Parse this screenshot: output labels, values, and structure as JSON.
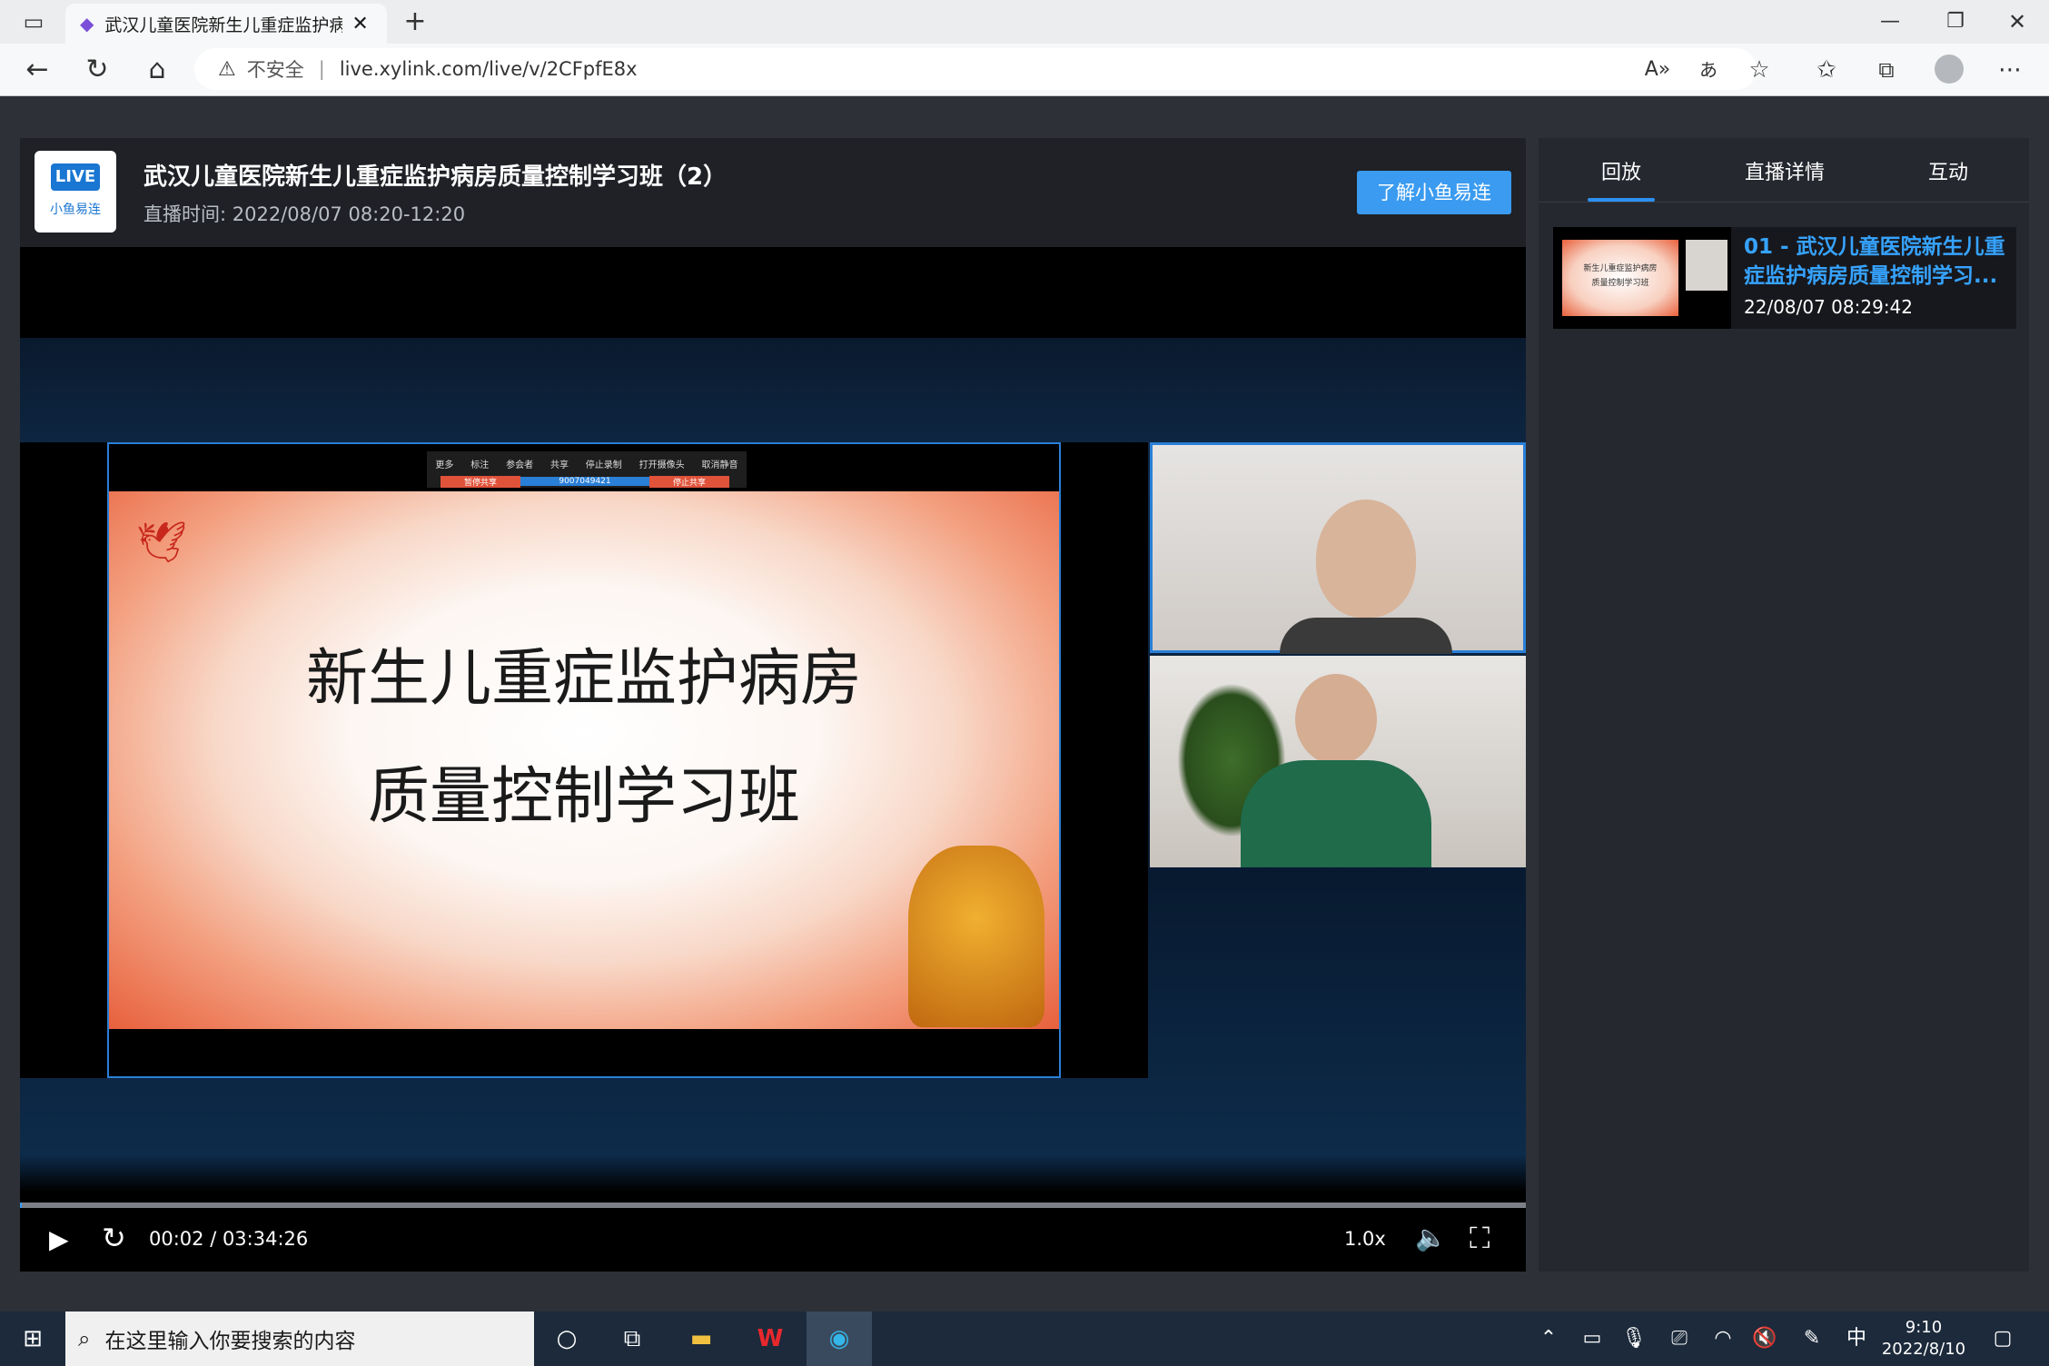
{
  "browser": {
    "tab_title": "武汉儿童医院新生儿重症监护病",
    "security_label": "不安全",
    "url": "live.xylink.com/live/v/2CFpfE8x"
  },
  "header": {
    "badge": "LIVE",
    "brand": "小鱼易连",
    "title": "武汉儿童医院新生儿重症监护病房质量控制学习班（2）",
    "time": "直播时间: 2022/08/07 08:20-12:20",
    "learn_button": "了解小鱼易连"
  },
  "slide": {
    "line1": "新生儿重症监护病房",
    "line2": "质量控制学习班",
    "meeting_id": "9007049421",
    "toolbar_left": "暂停共享",
    "toolbar_right": "停止共享",
    "toolbar_items": [
      "更多",
      "标注",
      "参会者",
      "共享",
      "停止录制",
      "打开摄像头",
      "取消静音"
    ],
    "thumb_line1": "新生儿重症监护病房",
    "thumb_line2": "质量控制学习班"
  },
  "player": {
    "progress": 0.0002,
    "time_display": "00:02 / 03:34:26",
    "speed": "1.0x"
  },
  "sidebar": {
    "tabs": [
      "回放",
      "直播详情",
      "互动"
    ],
    "active_tab": "回放",
    "item_title": "01 - 武汉儿童医院新生儿重症监护病房质量控制学习...",
    "item_time": "22/08/07 08:29:42"
  },
  "taskbar": {
    "search_placeholder": "在这里输入你要搜索的内容",
    "ime": "中",
    "clock_time": "9:10",
    "clock_date": "2022/8/10"
  },
  "colors": {
    "accent": "#3a9bf0",
    "page_bg": "#2d3037",
    "playlist_title": "#36a3ff"
  }
}
